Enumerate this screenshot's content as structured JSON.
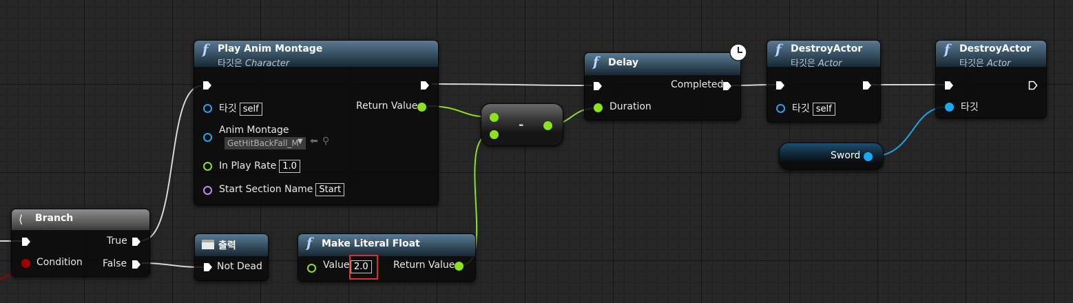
{
  "colors": {
    "exec": "#ffffff",
    "object_pin": "#1aa8f0",
    "float_pin": "#8ce21c",
    "bool_pin": "#a00000",
    "name_pin": "#c38df0",
    "highlight": "#e0302c",
    "function_header": "#3b5669"
  },
  "branch": {
    "title": "Branch",
    "true_label": "True",
    "condition_label": "Condition",
    "false_label": "False",
    "icon": "branch-icon"
  },
  "print": {
    "title": "출력",
    "pin_label": "Not Dead",
    "icon": "print-icon"
  },
  "play_anim": {
    "title": "Play Anim Montage",
    "subtitle_prefix": "타깃은",
    "subtitle_class": "Character",
    "target_label": "타깃",
    "target_value": "self",
    "return_label": "Return Value",
    "anim_label": "Anim Montage",
    "anim_value": "GetHitBackFall_M",
    "rate_label": "In Play Rate",
    "rate_value": "1.0",
    "section_label": "Start Section Name",
    "section_value": "Start"
  },
  "subtract": {
    "symbol": "-"
  },
  "literal": {
    "title": "Make Literal Float",
    "value_label": "Value",
    "value": "2.0",
    "return_label": "Return Value"
  },
  "delay": {
    "title": "Delay",
    "completed_label": "Completed",
    "duration_label": "Duration",
    "icon": "clock-icon"
  },
  "destroy1": {
    "title": "DestroyActor",
    "subtitle_prefix": "타깃은",
    "subtitle_class": "Actor",
    "target_label": "타깃",
    "target_value": "self"
  },
  "destroy2": {
    "title": "DestroyActor",
    "subtitle_prefix": "타깃은",
    "subtitle_class": "Actor",
    "target_label": "타깃"
  },
  "sword": {
    "label": "Sword"
  }
}
